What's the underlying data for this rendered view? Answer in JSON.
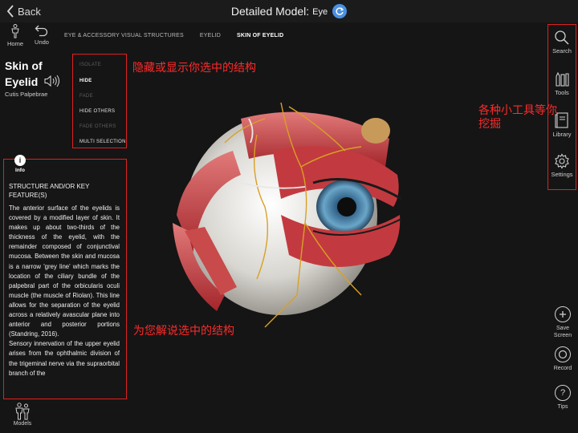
{
  "topbar": {
    "back_label": "Back",
    "title": "Detailed Model:",
    "model": "Eye"
  },
  "toolbar_left": {
    "home_label": "Home",
    "undo_label": "Undo"
  },
  "breadcrumb": [
    "EYE & ACCESSORY VISUAL STRUCTURES",
    "EYELID",
    "SKIN OF EYELID"
  ],
  "structure": {
    "name_line1": "Skin of",
    "name_line2": "Eyelid",
    "latin": "Cutis Palpebrae"
  },
  "visibility_menu": {
    "isolate": "ISOLATE",
    "hide": "HIDE",
    "fade": "FADE",
    "hide_others": "HIDE OTHERS",
    "fade_others": "FADE OTHERS",
    "multi_selection": "MULTI SELECTION"
  },
  "annotations": {
    "visibility": "隐藏或显示你选中的结构",
    "tools_line1": "各种小工具等你",
    "tools_line2": "挖掘",
    "info": "为您解说选中的结构"
  },
  "info": {
    "label": "Info",
    "heading": "STRUCTURE AND/OR KEY FEATURE(S)",
    "paragraph1": "The anterior surface of the eyelids is covered by a modified layer of skin. It makes up about two-thirds of the thickness of the eyelid, with the remainder composed of conjunctival mucosa. Between the skin and mucosa is a narrow 'grey line' which marks the location of the ciliary bundle of the palpebral part of the orbicularis oculi muscle (the muscle of Riolan). This line allows for the separation of the eyelid across a relatively avascular plane into anterior and posterior portions (Standring, 2016).",
    "paragraph2": "Sensory innervation of the upper eyelid arises from the ophthalmic division of the trigeminal nerve via the supraorbital branch of the"
  },
  "models_label": "Models",
  "right_tools": {
    "search": "Search",
    "tools": "Tools",
    "library": "Library",
    "settings": "Settings",
    "save_screen_line1": "Save",
    "save_screen_line2": "Screen",
    "record": "Record",
    "tips": "Tips"
  },
  "colors": {
    "annotation_red": "#ff2a2a",
    "accent_blue": "#4a90e2",
    "background": "#151515"
  }
}
